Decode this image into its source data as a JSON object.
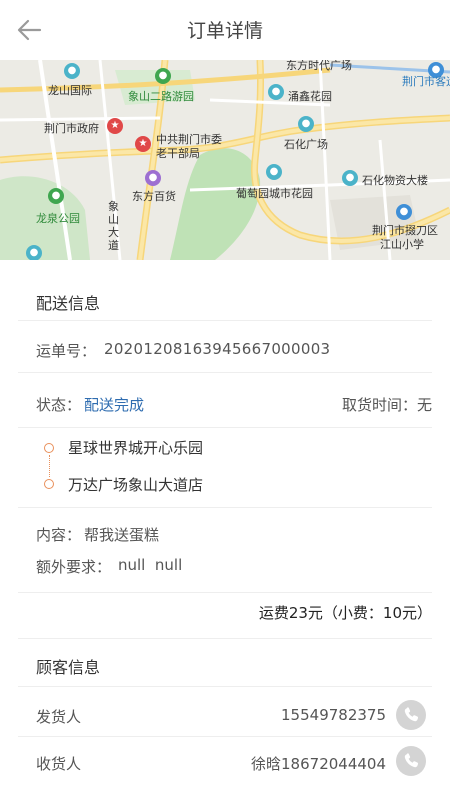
{
  "header": {
    "title": "订单详情",
    "back_icon": "back-arrow-icon"
  },
  "map": {
    "labels": {
      "dongfang_shidai": "东方时代广场",
      "jingmen_station": "荆门市客运",
      "longshan": "龙山国际",
      "xiangshan_road": "象山二路游园",
      "yongxin": "涌鑫花园",
      "gov": "荆门市政府",
      "party": "中共荆门市委",
      "party2": "老干部局",
      "shihua_square": "石化广场",
      "dongfang_store": "东方百货",
      "putao": "葡萄园城市花园",
      "shihua_building": "石化物资大楼",
      "longquan": "龙泉公园",
      "xiangshan_avenue": "象山大道",
      "duodao": "荆门市掇刀区",
      "jiangshan": "江山小学"
    }
  },
  "delivery": {
    "section_title": "配送信息",
    "waybill_label": "运单号：",
    "waybill_number": "2020120816394566700000З",
    "status_label": "状态：",
    "status_value": "配送完成",
    "pickup_label": "取货时间：",
    "pickup_value": "无",
    "from_address": "星球世界城开心乐园",
    "to_address": "万达广场象山大道店",
    "content_label": "内容：",
    "content_value": "帮我送蛋糕",
    "extra_label": "额外要求：",
    "extra_value": "null  null",
    "fee_text": "运费23元（小费：10元）"
  },
  "customer": {
    "section_title": "顾客信息",
    "sender_label": "发货人",
    "sender_phone": "15549782375",
    "receiver_label": "收货人",
    "receiver_name_phone": "徐晗18672044404"
  },
  "colors": {
    "accent_blue": "#2e6cb0",
    "route_orange": "#e9905b",
    "phone_grey": "#d4d4d4"
  }
}
